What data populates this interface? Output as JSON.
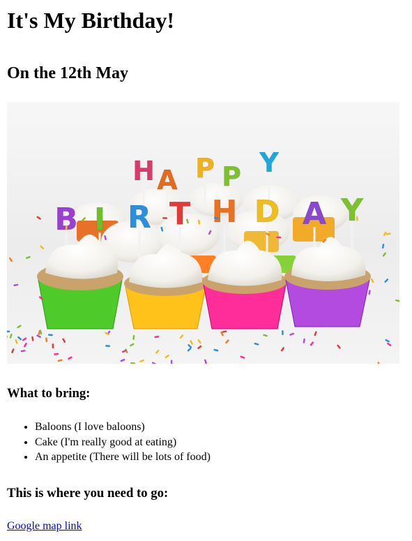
{
  "page": {
    "title": "It's My Birthday!",
    "date_heading": "On the 12th May",
    "image": {
      "candle_letters_top": [
        "H",
        "A",
        "P",
        "P",
        "Y"
      ],
      "candle_letters_bottom": [
        "B",
        "I",
        "R",
        "T",
        "H",
        "D",
        "A",
        "Y"
      ],
      "candle_colors_top": [
        "#d83a6a",
        "#e56a1c",
        "#f0b21c",
        "#7cc22e",
        "#1fa7d9"
      ],
      "candle_colors_bottom": [
        "#9a3fd1",
        "#6dc02a",
        "#2a8fdc",
        "#e03a3a",
        "#e87220",
        "#f1bd1e",
        "#8a48cf",
        "#7cc22e"
      ],
      "cupcake_liner_colors": [
        "#4ecb2a",
        "#ffc21a",
        "#ff2d9a",
        "#b44be0"
      ]
    },
    "bring_heading": "What to bring:",
    "bring_items": [
      "Baloons (I love baloons)",
      "Cake (I'm really good at eating)",
      "An appetite (There will be lots of food)"
    ],
    "go_heading": "This is where you need to go:",
    "map_link_text": "Google map link"
  }
}
